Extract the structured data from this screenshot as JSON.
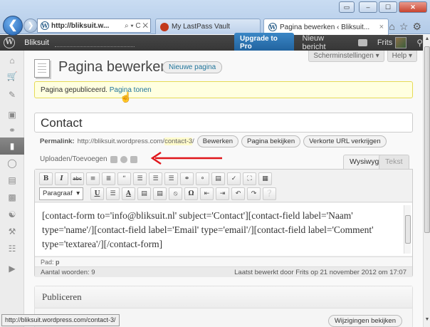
{
  "browser": {
    "address": "http://bliksuit.w...",
    "address_icons": "⌕ ▾ C ✕",
    "tabs": [
      {
        "label": "My LastPass Vault"
      },
      {
        "label": "Pagina bewerken ‹ Bliksuit...",
        "close": "×"
      }
    ],
    "status_url": "http://bliksuit.wordpress.com/contact-3/"
  },
  "adminbar": {
    "site": "Bliksuit",
    "upgrade": "Upgrade to Pro",
    "new_post": "Nieuw bericht",
    "user": "Frits"
  },
  "header": {
    "screen_options": "Scherminstellingen ▾",
    "help": "Help ▾",
    "title": "Pagina bewerken",
    "new_page": "Nieuwe pagina"
  },
  "notice": {
    "text": "Pagina gepubliceerd.",
    "link": "Pagina tonen"
  },
  "post": {
    "title": "Contact",
    "permalink_label": "Permalink:",
    "permalink_base": "http://bliksuit.wordpress.com/",
    "permalink_slug": "contact-3",
    "permalink_end": "/",
    "buttons": [
      "Bewerken",
      "Pagina bekijken",
      "Verkorte URL verkrijgen"
    ]
  },
  "editor": {
    "upload_label": "Uploaden/Toevoegen",
    "tab_visual": "Wysiwyg",
    "tab_html": "Tekst",
    "format_select": "Paragraaf",
    "content": "[contact-form to='info@bliksuit.nl' subject='Contact'][contact-field label='Naam' type='name'/][contact-field label='Email' type='email'/][contact-field label='Comment' type='textarea'/][/contact-form]",
    "path_label": "Pad:",
    "path_value": "p",
    "word_count": "Aantal woorden: 9",
    "last_edit": "Laatst bewerkt door Frits op 21 november 2012 om 17:07"
  },
  "publish": {
    "heading": "Publiceren",
    "preview": "Wijzigingen bekijken"
  },
  "colors": {
    "accent_link": "#21759b",
    "annotation_arrow": "#e0161b",
    "notice_bg": "#ffffe0"
  }
}
